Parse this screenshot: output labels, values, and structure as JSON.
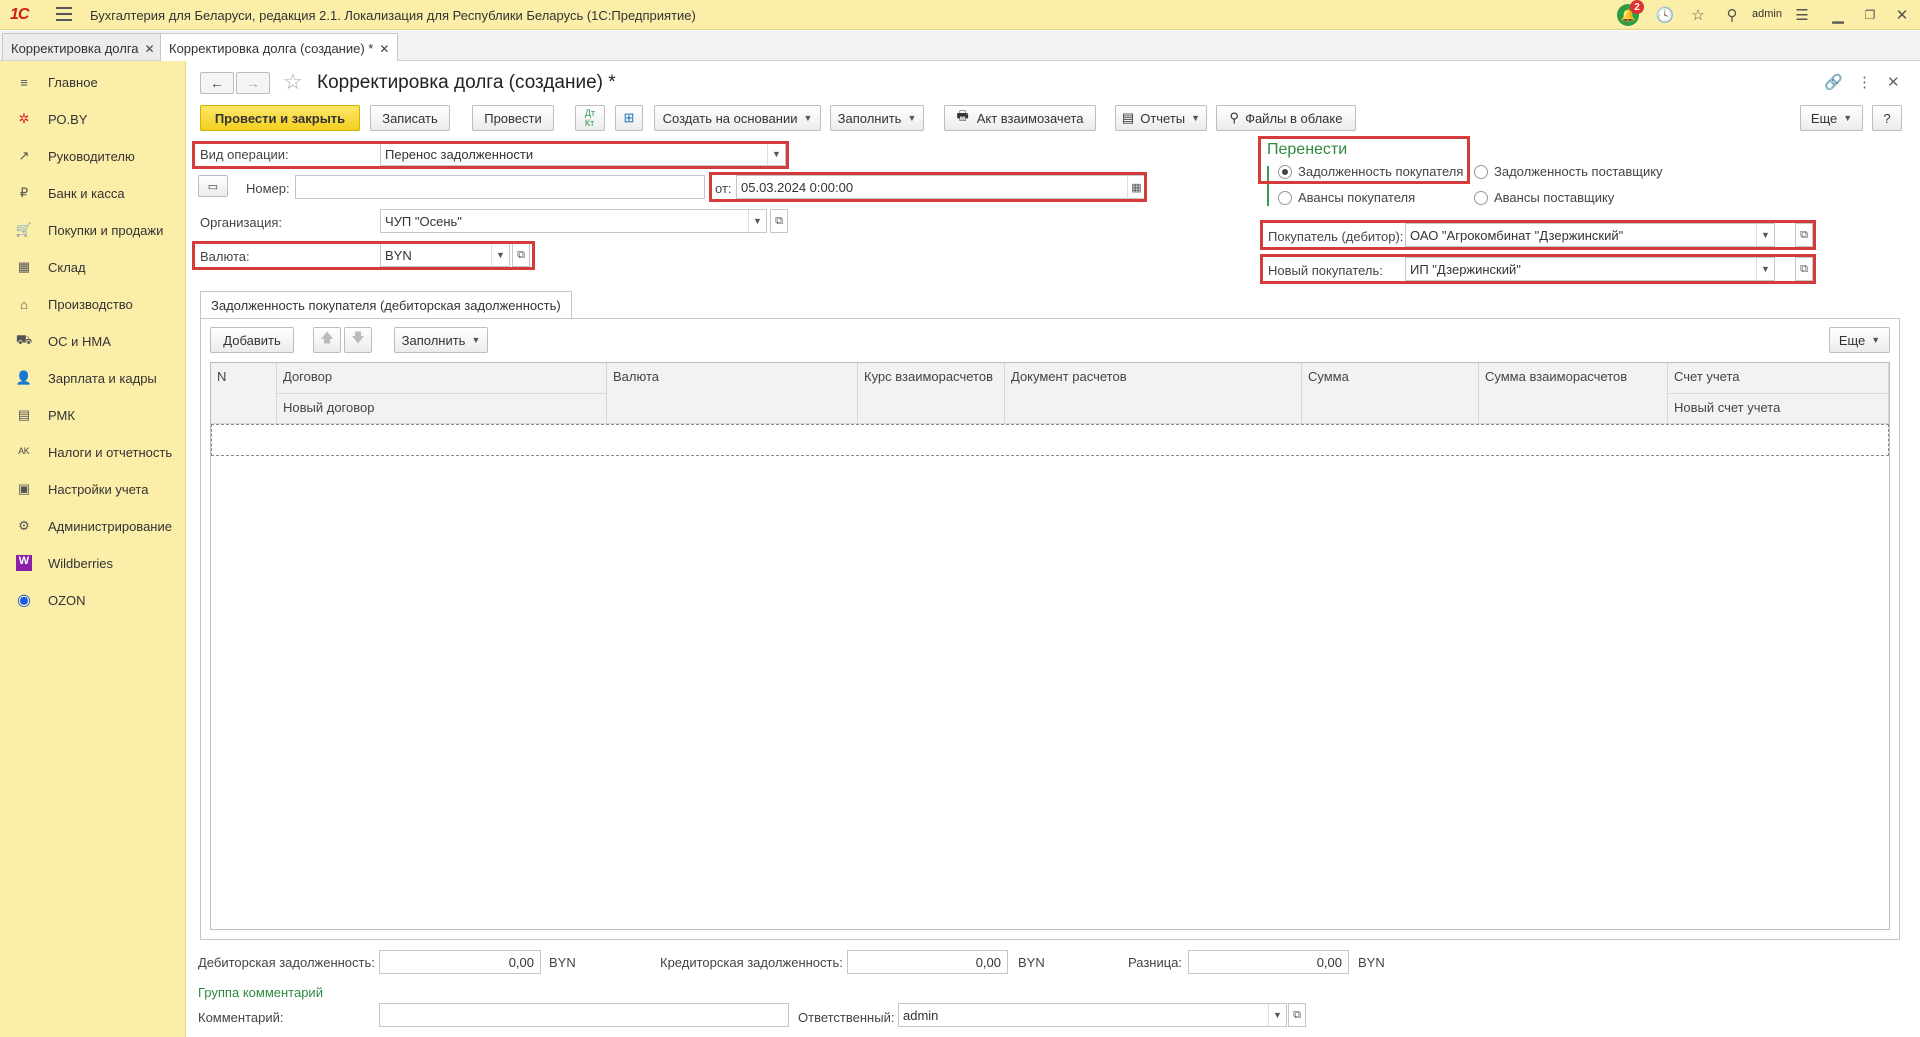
{
  "app": {
    "logo": "1С",
    "title": "Бухгалтерия для Беларуси, редакция 2.1. Локализация для Республики Беларусь   (1С:Предприятие)",
    "notification_count": "2",
    "user": "admin"
  },
  "tabs": [
    {
      "label": "Корректировка долга",
      "close": "✕"
    },
    {
      "label": "Корректировка долга (создание) *",
      "close": "✕"
    }
  ],
  "sidebar": {
    "items": [
      {
        "label": "Главное",
        "icon": "≡"
      },
      {
        "label": "РО.BY",
        "icon": "✲"
      },
      {
        "label": "Руководителю",
        "icon": "↗"
      },
      {
        "label": "Банк и касса",
        "icon": "₽"
      },
      {
        "label": "Покупки и продажи",
        "icon": "🛒"
      },
      {
        "label": "Склад",
        "icon": "▦"
      },
      {
        "label": "Производство",
        "icon": "⌂"
      },
      {
        "label": "ОС и НМА",
        "icon": "⛟"
      },
      {
        "label": "Зарплата и кадры",
        "icon": "👤"
      },
      {
        "label": "РМК",
        "icon": "▤"
      },
      {
        "label": "Налоги и отчетность",
        "icon": "ᴬᴷ"
      },
      {
        "label": "Настройки учета",
        "icon": "▣"
      },
      {
        "label": "Администрирование",
        "icon": "⚙"
      },
      {
        "label": "Wildberries",
        "icon": "W"
      },
      {
        "label": "OZON",
        "icon": "◉"
      }
    ]
  },
  "form": {
    "title": "Корректировка долга (создание) *",
    "toolbar": {
      "post_close": "Провести и закрыть",
      "save": "Записать",
      "post": "Провести",
      "create_based": "Создать на основании",
      "fill": "Заполнить",
      "netting_act": "Акт взаимозачета",
      "reports": "Отчеты",
      "cloud_files": "Файлы в облаке",
      "more": "Еще",
      "help": "?"
    },
    "operation_type": {
      "label": "Вид операции:",
      "value": "Перенос задолженности"
    },
    "number": {
      "label": "Номер:",
      "value": ""
    },
    "date": {
      "label": "от:",
      "value": "05.03.2024  0:00:00"
    },
    "organization": {
      "label": "Организация:",
      "value": "ЧУП \"Осень\""
    },
    "currency": {
      "label": "Валюта:",
      "value": "BYN"
    },
    "transfer": {
      "title": "Перенести",
      "options": [
        "Задолженность покупателя",
        "Задолженность поставщику",
        "Авансы покупателя",
        "Авансы поставщику"
      ],
      "selected": "Задолженность покупателя"
    },
    "buyer": {
      "label": "Покупатель (дебитор):",
      "value": "ОАО \"Агрокомбинат \"Дзержинский\""
    },
    "new_buyer": {
      "label": "Новый покупатель:",
      "value": "ИП \"Дзержинский\""
    },
    "section_tab": "Задолженность покупателя (дебиторская задолженность)",
    "table_toolbar": {
      "add": "Добавить",
      "fill": "Заполнить",
      "more": "Еще"
    },
    "table_headers": {
      "n": "N",
      "contract": "Договор",
      "new_contract": "Новый договор",
      "currency": "Валюта",
      "rate": "Курс взаиморасчетов",
      "settlement_doc": "Документ расчетов",
      "amount": "Сумма",
      "settlement_amount": "Сумма взаиморасчетов",
      "account": "Счет учета",
      "new_account": "Новый счет учета"
    },
    "totals": {
      "receivable_label": "Дебиторская задолженность:",
      "receivable_value": "0,00",
      "payable_label": "Кредиторская задолженность:",
      "payable_value": "0,00",
      "difference_label": "Разница:",
      "difference_value": "0,00",
      "currency": "BYN"
    },
    "comment_group": "Группа комментарий",
    "comment": {
      "label": "Комментарий:",
      "value": ""
    },
    "responsible": {
      "label": "Ответственный:",
      "value": "admin"
    }
  },
  "colors": {
    "accent_yellow": "#fbeea8",
    "highlight_red": "#d43b3b",
    "group_green": "#2d8a3e"
  }
}
